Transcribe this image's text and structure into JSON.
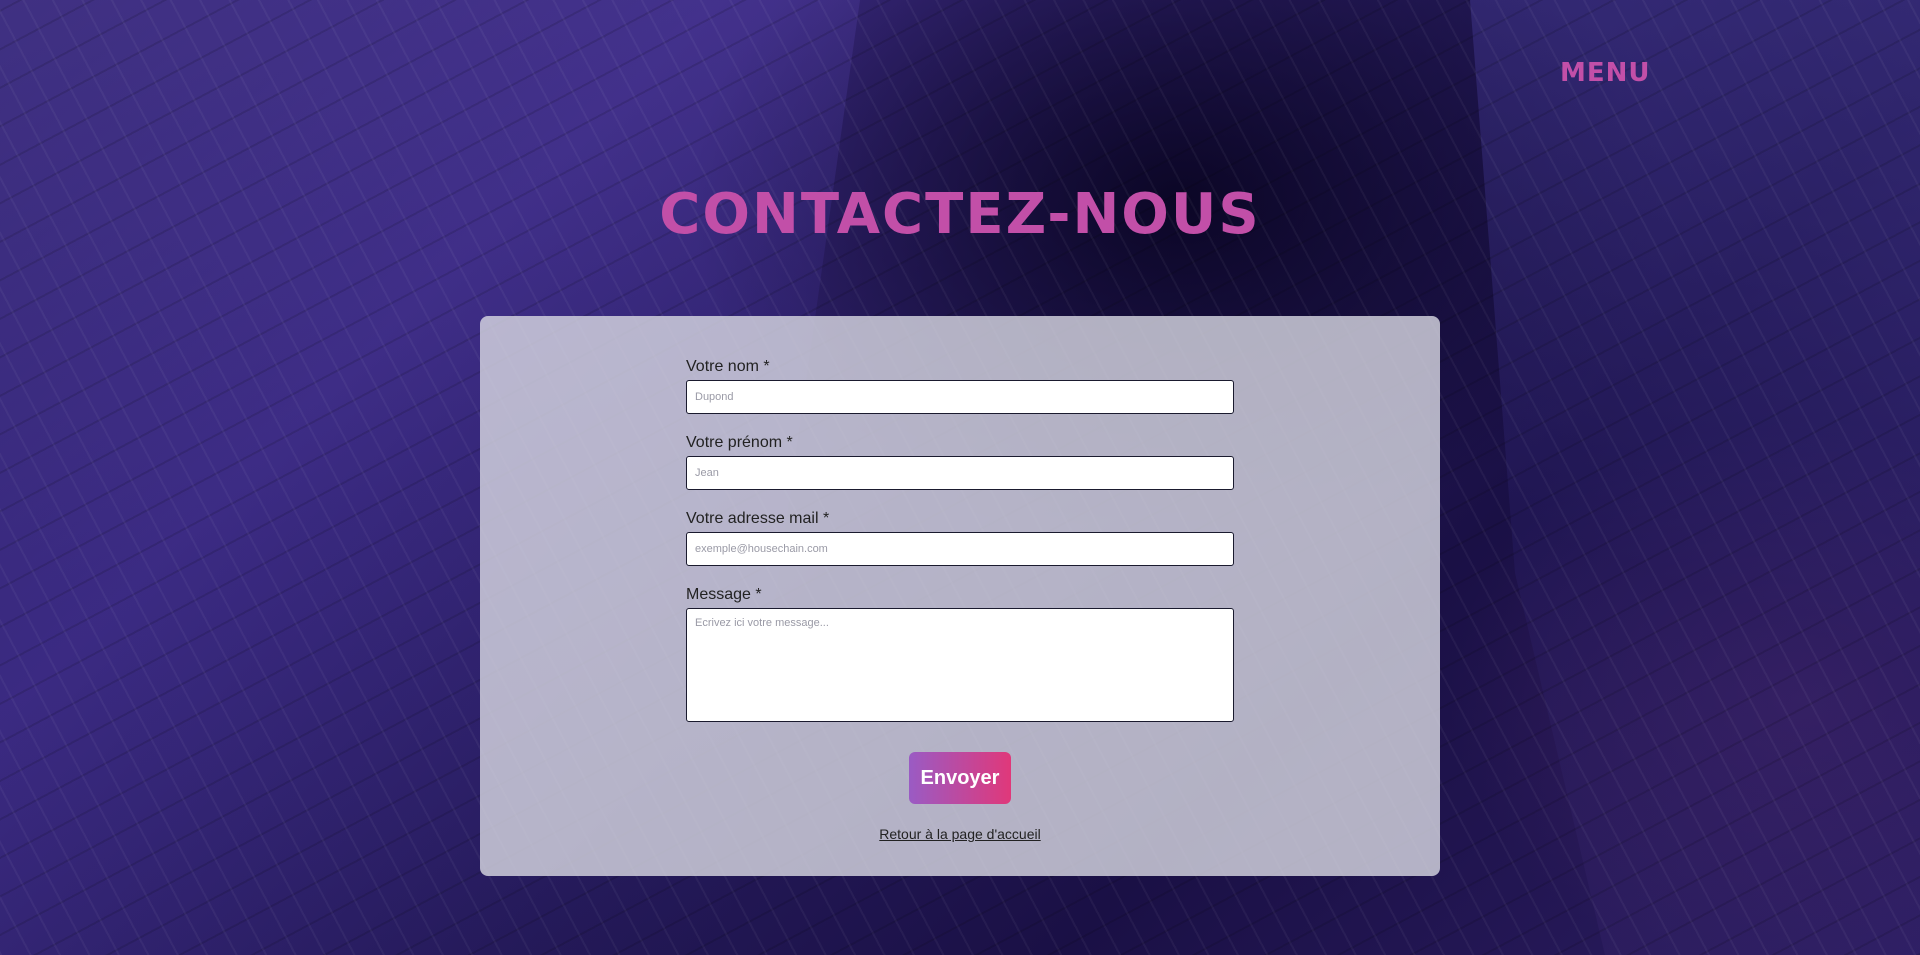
{
  "header": {
    "menu_label": "MENU"
  },
  "page": {
    "title": "CONTACTEZ-NOUS"
  },
  "form": {
    "name": {
      "label": "Votre nom *",
      "placeholder": "Dupond",
      "value": ""
    },
    "firstname": {
      "label": "Votre prénom *",
      "placeholder": "Jean",
      "value": ""
    },
    "email": {
      "label": "Votre adresse mail *",
      "placeholder": "exemple@housechain.com",
      "value": ""
    },
    "message": {
      "label": "Message *",
      "placeholder": "Ecrivez ici votre message...",
      "value": ""
    },
    "submit_label": "Envoyer",
    "back_link": "Retour à la page d'accueil"
  },
  "colors": {
    "accent": "#c24fa8",
    "button_gradient_start": "#9a5bc4",
    "button_gradient_end": "#e0387a",
    "panel": "#d6d6e0",
    "background": "#2a1f62"
  }
}
